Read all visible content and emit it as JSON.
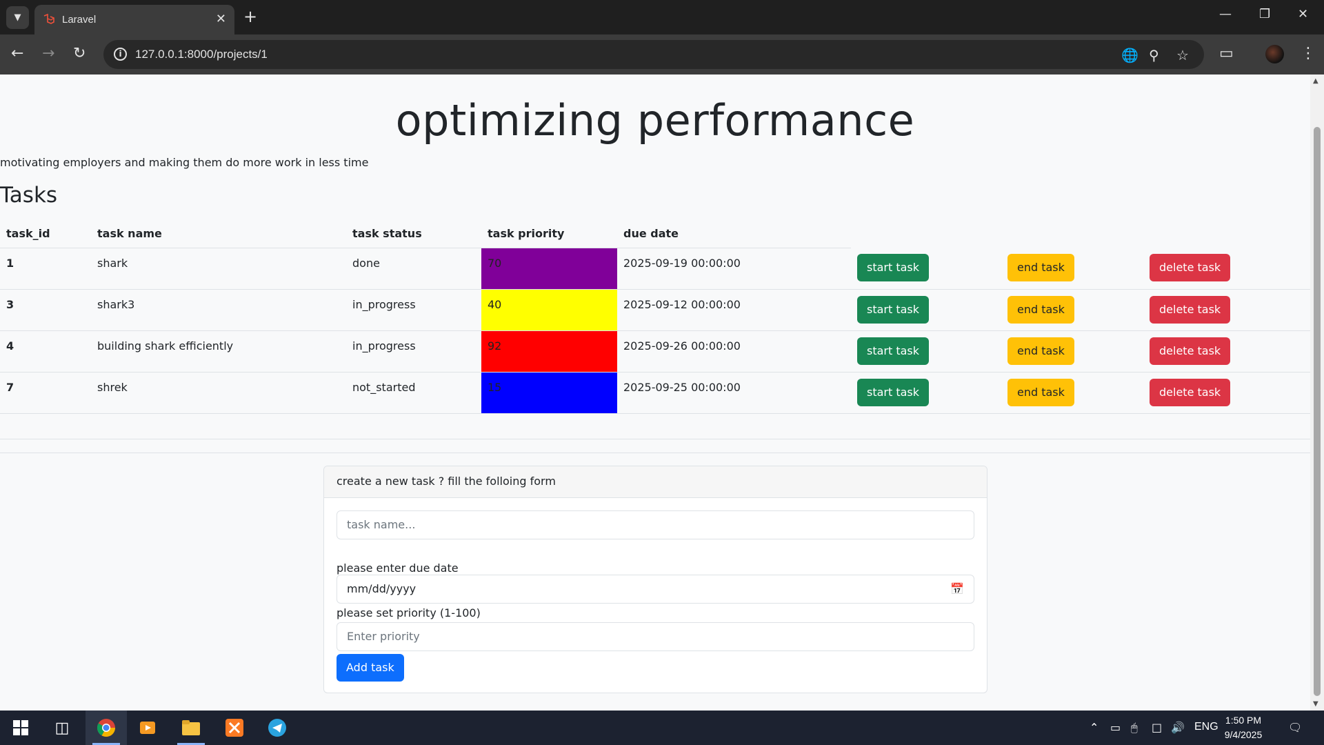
{
  "browser": {
    "tab_title": "Laravel",
    "new_tab": "+",
    "tab_close": "✕",
    "url": "127.0.0.1:8000/projects/1"
  },
  "page": {
    "title": "optimizing performance",
    "description": "motivating employers and making them do more work in less time",
    "tasks_heading": "Tasks"
  },
  "table": {
    "headers": [
      "task_id",
      "task name",
      "task status",
      "task priority",
      "due date"
    ],
    "rows": [
      {
        "id": "1",
        "name": "shark",
        "status": "done",
        "priority": "70",
        "priority_color": "#800099",
        "due": "2025-09-19 00:00:00"
      },
      {
        "id": "3",
        "name": "shark3",
        "status": "in_progress",
        "priority": "40",
        "priority_color": "#ffff00",
        "due": "2025-09-12 00:00:00"
      },
      {
        "id": "4",
        "name": "building shark efficiently",
        "status": "in_progress",
        "priority": "92",
        "priority_color": "#ff0000",
        "due": "2025-09-26 00:00:00"
      },
      {
        "id": "7",
        "name": "shrek",
        "status": "not_started",
        "priority": "15",
        "priority_color": "#0000ff",
        "due": "2025-09-25 00:00:00"
      }
    ],
    "start_label": "start task",
    "end_label": "end task",
    "delete_label": "delete task"
  },
  "form": {
    "header": "create a new task ? fill the folloing form",
    "task_name_placeholder": "task name...",
    "due_date_label": "please enter due date",
    "due_date_placeholder": "mm/dd/yyyy",
    "priority_label": "please set priority (1-100)",
    "priority_placeholder": "Enter priority",
    "submit_label": "Add task"
  },
  "taskbar": {
    "language": "ENG",
    "time": "1:50 PM",
    "date": "9/4/2025"
  },
  "colors": {
    "start": "#198754",
    "end": "#ffc107",
    "delete": "#dc3545",
    "primary": "#0d6efd"
  }
}
